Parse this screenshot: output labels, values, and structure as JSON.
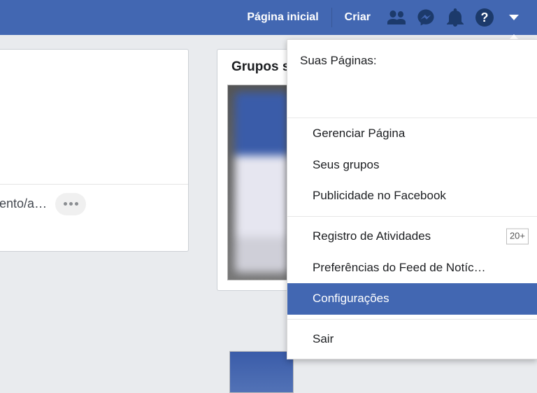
{
  "topbar": {
    "home_label": "Página inicial",
    "create_label": "Criar"
  },
  "left_panel": {
    "truncated_text": "Sentimento/a…"
  },
  "right_panel": {
    "heading": "Grupos s"
  },
  "dropdown": {
    "header": "Suas Páginas:",
    "items": [
      {
        "label": "Gerenciar Página"
      },
      {
        "label": "Seus grupos"
      },
      {
        "label": "Publicidade no Facebook"
      },
      {
        "label": "Registro de Atividades",
        "badge": "20+"
      },
      {
        "label": "Preferências do Feed de Notíc…"
      },
      {
        "label": "Configurações"
      },
      {
        "label": "Sair"
      }
    ]
  }
}
